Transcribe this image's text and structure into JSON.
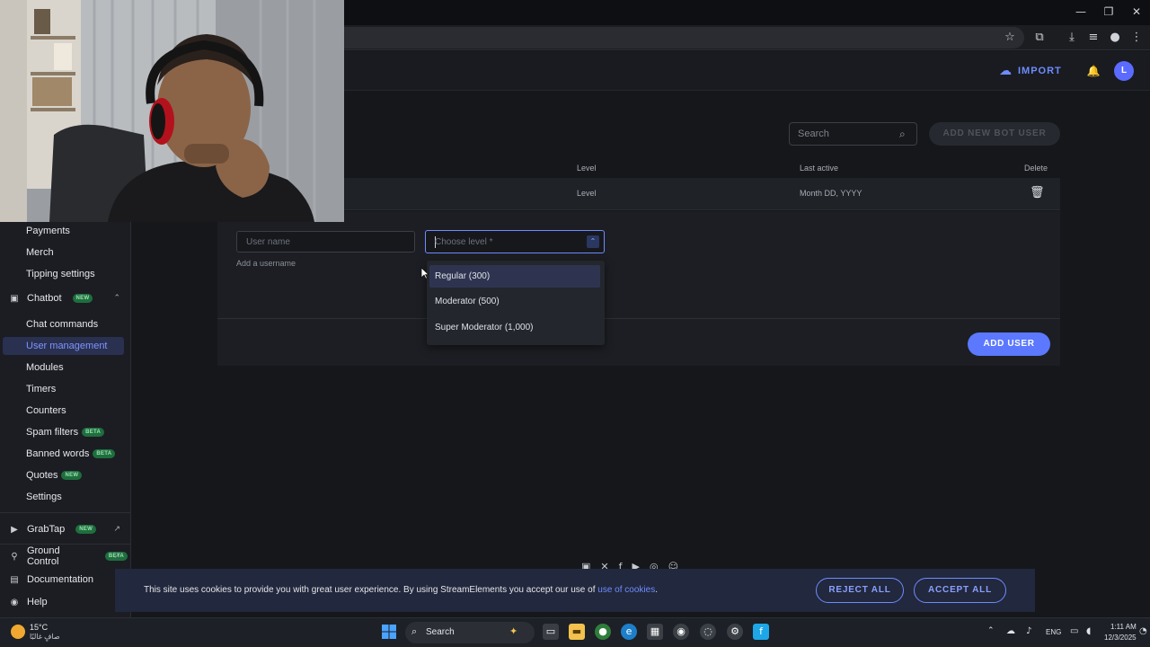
{
  "window": {
    "min_glyph": "—",
    "max_glyph": "❐",
    "close_glyph": "✕"
  },
  "browser": {
    "icons": [
      "star-icon",
      "extensions-icon",
      "download-icon",
      "media-control-icon",
      "profile-icon",
      "more-icon"
    ],
    "glyphs": {
      "star": "☆",
      "ext": "⧉",
      "download": "⤓",
      "media": "≡",
      "profile": "●",
      "more": "⋮"
    }
  },
  "header": {
    "import_label": "IMPORT",
    "import_icon": "☁",
    "bell_glyph": "🔔",
    "avatar_initial": "L"
  },
  "toolbar": {
    "search_placeholder": "Search",
    "search_glyph": "⌕",
    "add_bot_label": "ADD NEW BOT USER"
  },
  "table": {
    "columns": {
      "level": "Level",
      "last_active": "Last active",
      "delete": "Delete"
    },
    "row": {
      "level": "Level",
      "last_active": "Month DD, YYYY",
      "delete_glyph": "🗑"
    }
  },
  "form": {
    "username_placeholder": "User name",
    "username_helper": "Add a username",
    "level_placeholder": "Choose level *",
    "chevron_glyph": "⌃",
    "options": [
      {
        "label": "Regular (300)"
      },
      {
        "label": "Moderator (500)"
      },
      {
        "label": "Super Moderator (1,000)"
      }
    ],
    "add_user_label": "ADD USER"
  },
  "sidebar": {
    "items": [
      {
        "label": "Payments"
      },
      {
        "label": "Merch"
      },
      {
        "label": "Tipping settings"
      },
      {
        "label": "Chatbot",
        "badge": "NEW",
        "chev": "⌃"
      },
      {
        "label": "Chat commands"
      },
      {
        "label": "User management"
      },
      {
        "label": "Modules"
      },
      {
        "label": "Timers"
      },
      {
        "label": "Counters"
      },
      {
        "label": "Spam filters",
        "badge": "BETA"
      },
      {
        "label": "Banned words",
        "badge": "BETA"
      },
      {
        "label": "Quotes",
        "badge": "NEW"
      },
      {
        "label": "Settings"
      },
      {
        "label": "GrabTap",
        "badge": "NEW",
        "ext": "↗"
      },
      {
        "label": "Ground Control",
        "badge": "BETA",
        "ext": "↗"
      },
      {
        "label": "Documentation"
      },
      {
        "label": "Help"
      }
    ]
  },
  "cookie": {
    "text": "This site uses cookies to provide you with great user experience. By using StreamElements you accept our use of ",
    "link": "use of cookies",
    "period": ".",
    "reject_label": "REJECT ALL",
    "accept_label": "ACCEPT ALL"
  },
  "taskbar": {
    "weather_temp": "15°C",
    "weather_desc": "صافٍ غالبًا",
    "search_label": "Search",
    "search_glyph": "⌕",
    "lang": "ENG",
    "time": "1:11 AM",
    "date": "12/3/2025"
  },
  "colors": {
    "accent": "#6e8cff",
    "primary_button": "#5b78ff",
    "badge_green": "#1f6e3e"
  }
}
